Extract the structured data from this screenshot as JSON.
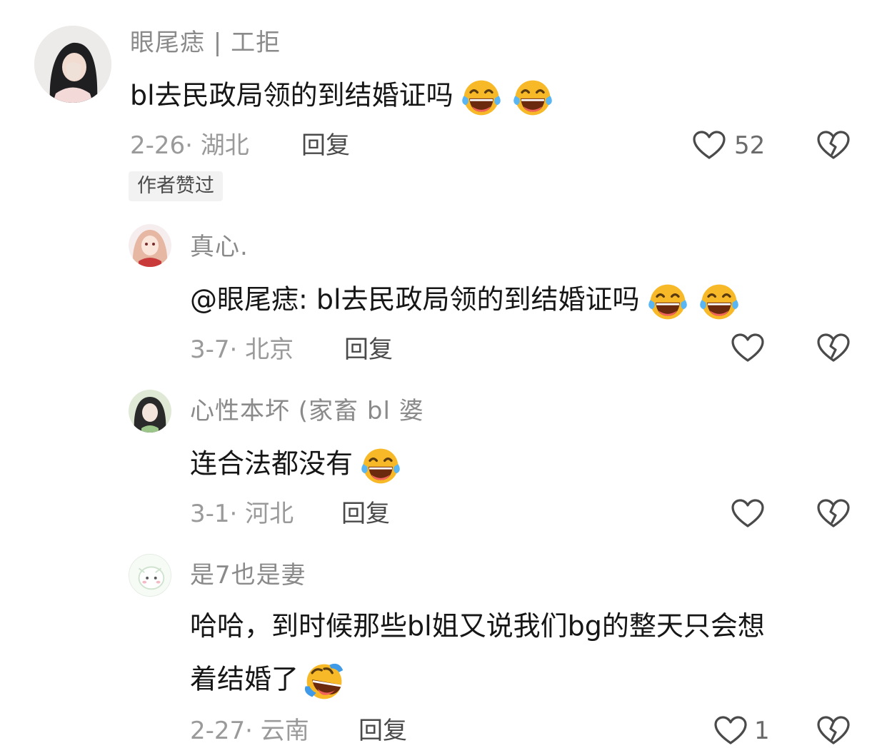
{
  "comments": [
    {
      "username": "眼尾痣 | 工拒",
      "text": "bl去民政局领的到结婚证吗",
      "date_location": "2-26· 湖北",
      "reply_label": "回复",
      "like_count": "52",
      "badge": "作者赞过",
      "avatar_icon": "user-avatar-dark-hair",
      "emojis": [
        "laughing-tears-emoji",
        "laughing-tears-emoji"
      ]
    }
  ],
  "replies": [
    {
      "username": "真心.",
      "text": "@眼尾痣: bl去民政局领的到结婚证吗",
      "date_location": "3-7· 北京",
      "reply_label": "回复",
      "like_count": "",
      "avatar_icon": "user-avatar-anime-pink",
      "emojis": [
        "laughing-tears-emoji",
        "laughing-tears-emoji"
      ]
    },
    {
      "username": "心性本坏 (家畜 bl 婆",
      "text": "连合法都没有",
      "date_location": "3-1· 河北",
      "reply_label": "回复",
      "like_count": "",
      "avatar_icon": "user-avatar-anime-green",
      "emojis": [
        "laughing-tears-emoji"
      ]
    },
    {
      "username": "是7也是妻",
      "text_line1": "哈哈，到时候那些bl姐又说我们bg的整天只会想",
      "text_line2": "着结婚了",
      "date_location": "2-27· 云南",
      "reply_label": "回复",
      "like_count": "1",
      "avatar_icon": "user-avatar-cartoon-white",
      "emojis": [
        "rolling-laughing-emoji"
      ]
    }
  ],
  "colors": {
    "username": "#8a8a8a",
    "text": "#161616",
    "meta": "#9a9a9a",
    "icon_stroke": "#4a4a4a",
    "badge_bg": "#f2f2f2",
    "emoji_yellow": "#f7b928"
  },
  "icons": {
    "like": "heart-outline-icon",
    "dislike": "broken-heart-icon"
  }
}
